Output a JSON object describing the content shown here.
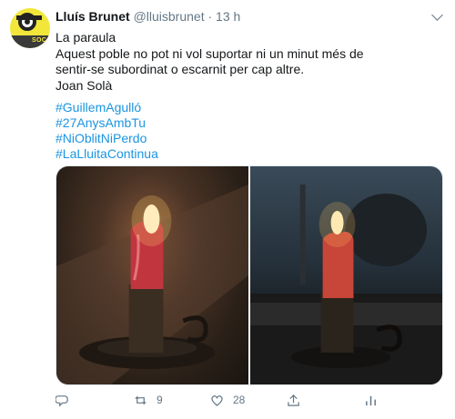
{
  "tweet": {
    "author_name": "Lluís Brunet",
    "author_handle": "@lluisbrunet",
    "separator": "·",
    "time": "13 h",
    "avatar_text": "SOC",
    "lines": [
      "La paraula",
      "Aquest poble no pot ni vol suportar ni un minut més de sentir-se subordinat o escarnit per cap altre.",
      "Joan Solà"
    ],
    "hashtags": [
      "#GuillemAgulló",
      "#27AnysAmbTu",
      "#NiOblitNiPerdo",
      "#LaLluitaContinua"
    ]
  },
  "actions": {
    "retweets": "9",
    "likes": "28"
  },
  "colors": {
    "link": "#1b95e0",
    "muted": "#657786",
    "text": "#14171a"
  }
}
